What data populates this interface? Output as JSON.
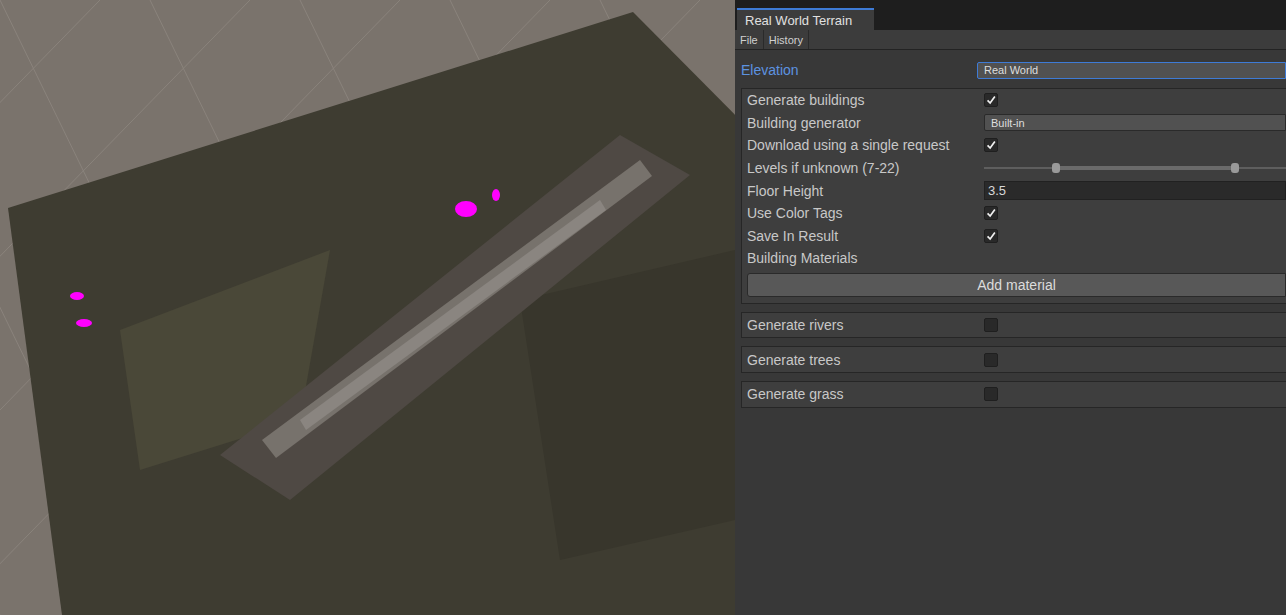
{
  "window": {
    "title": "Real World Terrain"
  },
  "tabs": [
    {
      "label": "Real World Terrain",
      "selected": true
    }
  ],
  "menu": [
    "File",
    "History"
  ],
  "elevation": {
    "label": "Elevation",
    "value": "Real World",
    "focused": true
  },
  "building_settings": [
    {
      "kind": "checkbox",
      "label": "Generate buildings",
      "checked": true
    },
    {
      "kind": "dropdown",
      "label": "Building generator",
      "value": "Built-in"
    },
    {
      "kind": "checkbox",
      "label": "Download using a single request",
      "checked": true
    },
    {
      "kind": "range",
      "label": "Levels if unknown (7-22)",
      "low": 0.24,
      "high": 0.83
    },
    {
      "kind": "field",
      "label": "Floor Height",
      "value": "3.5"
    },
    {
      "kind": "checkbox",
      "label": "Use Color Tags",
      "checked": true
    },
    {
      "kind": "checkbox",
      "label": "Save In Result",
      "checked": true
    },
    {
      "kind": "label",
      "label": "Building Materials"
    },
    {
      "kind": "button",
      "label": "Add material"
    }
  ],
  "generators": [
    {
      "label": "Generate rivers",
      "checked": false
    },
    {
      "label": "Generate trees",
      "checked": false
    },
    {
      "label": "Generate grass",
      "checked": false
    }
  ]
}
